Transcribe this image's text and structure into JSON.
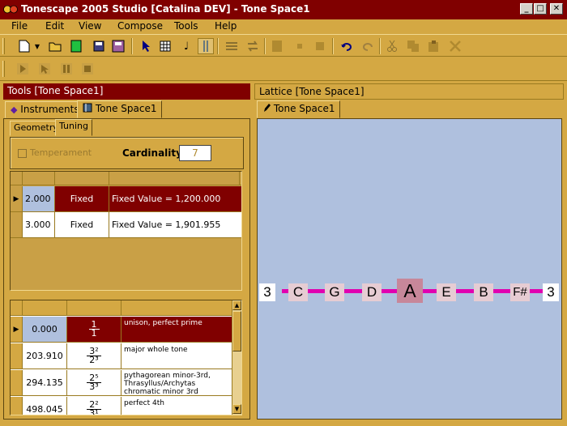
{
  "window": {
    "title": "Tonescape 2005 Studio [Catalina DEV]  -  Tone Space1",
    "minimize": "_",
    "maximize": "□",
    "close": "✕"
  },
  "menu": [
    "File",
    "Edit",
    "View",
    "Compose",
    "Tools",
    "Help"
  ],
  "left_panel": {
    "header": "Tools  [Tone Space1]",
    "tabs": [
      "Instruments",
      "Tone Space1"
    ],
    "subtabs": [
      "Geometry",
      "Tuning"
    ],
    "temperament_label": "Temperament",
    "cardinality_label": "Cardinality",
    "cardinality_value": "7",
    "generators": [
      {
        "value": "2.000",
        "mode": "Fixed",
        "desc": "Fixed Value = 1,200.000",
        "selected": true
      },
      {
        "value": "3.000",
        "mode": "Fixed",
        "desc": "Fixed Value = 1,901.955",
        "selected": false
      }
    ],
    "intervals": [
      {
        "cents": "0.000",
        "num": "1",
        "den": "1",
        "name": "unison, perfect prime",
        "selected": true
      },
      {
        "cents": "203.910",
        "num": "3²",
        "den": "2³",
        "name": "major whole tone",
        "selected": false
      },
      {
        "cents": "294.135",
        "num": "2⁵",
        "den": "3³",
        "name": "pythagorean minor-3rd, Thrasyllus/Archytas chromatic minor 3rd",
        "selected": false
      },
      {
        "cents": "498.045",
        "num": "2²",
        "den": "3¹",
        "name": "perfect 4th",
        "selected": false
      }
    ]
  },
  "right_panel": {
    "header": "Lattice  [Tone Space1]",
    "tab": "Tone Space1",
    "notes": [
      "3",
      "C",
      "G",
      "D",
      "A",
      "E",
      "B",
      "F#",
      "3"
    ],
    "highlighted_note": "A",
    "colors": {
      "background": "#afc0de",
      "connector": "#e000b0",
      "note_box": "#e6ccd3",
      "highlight": "#c7879a"
    }
  }
}
